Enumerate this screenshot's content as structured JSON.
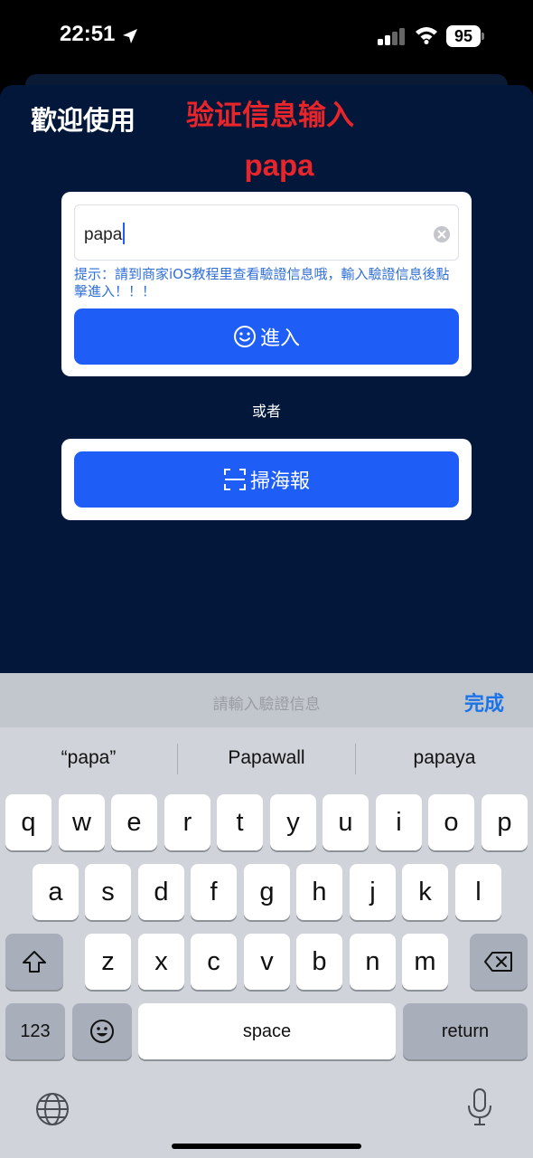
{
  "status_bar": {
    "time": "22:51",
    "battery": "95"
  },
  "header": {
    "welcome": "歡迎使用",
    "overlay_title": "验证信息输入",
    "overlay_subtitle": "papa"
  },
  "login_card": {
    "input_value": "papa",
    "hint": "提示：請到商家iOS教程里查看驗證信息哦，輸入驗證信息後點擊進入！！！",
    "enter_label": "進入"
  },
  "or_label": "或者",
  "scan_card": {
    "scan_label": "掃海報"
  },
  "keyboard": {
    "accessory_placeholder": "請輸入驗證信息",
    "done_label": "完成",
    "suggestions": [
      "“papa”",
      "Papawall",
      "papaya"
    ],
    "row1": [
      "q",
      "w",
      "e",
      "r",
      "t",
      "y",
      "u",
      "i",
      "o",
      "p"
    ],
    "row2": [
      "a",
      "s",
      "d",
      "f",
      "g",
      "h",
      "j",
      "k",
      "l"
    ],
    "row3": [
      "z",
      "x",
      "c",
      "v",
      "b",
      "n",
      "m"
    ],
    "numbers_label": "123",
    "space_label": "space",
    "return_label": "return"
  },
  "colors": {
    "background": "#02173a",
    "accent": "#1f5ef6",
    "overlay_red": "#e8252a"
  }
}
